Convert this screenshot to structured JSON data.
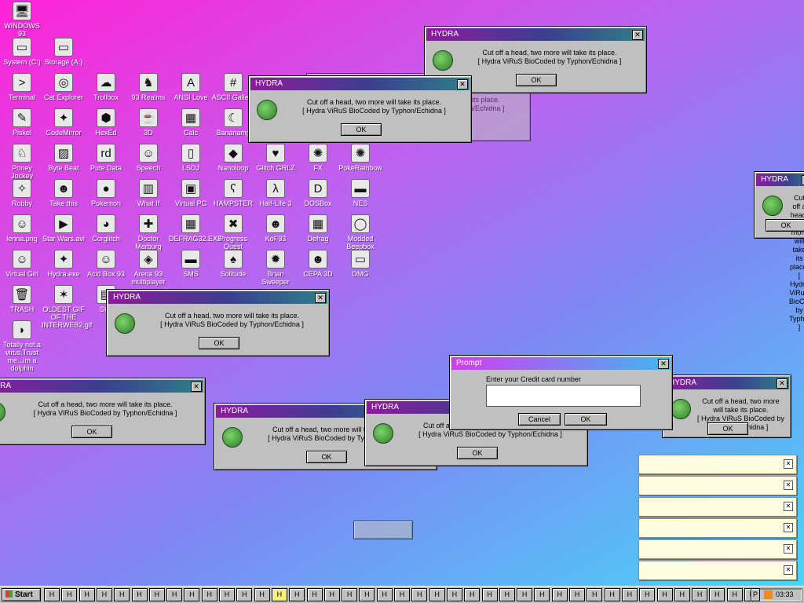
{
  "desktop_icons": [
    {
      "label": "WINDOWS 93",
      "icon": "computer-icon",
      "glyph": "🖥"
    },
    {
      "label": "System (C:)",
      "icon": "drive-icon",
      "glyph": "▭"
    },
    {
      "label": "Storage (A:)",
      "icon": "floppy-drive-icon",
      "glyph": "▭"
    },
    {
      "label": "Terminal",
      "icon": "terminal-icon",
      "glyph": ">"
    },
    {
      "label": "Cat Explorer",
      "icon": "globe-icon",
      "glyph": "◎"
    },
    {
      "label": "Trollbox",
      "icon": "chat-icon",
      "glyph": "☁"
    },
    {
      "label": "93 Realms",
      "icon": "realms-icon",
      "glyph": "♞"
    },
    {
      "label": "ANSI Love",
      "icon": "ansi-icon",
      "glyph": "A"
    },
    {
      "label": "ASCII Gallery",
      "icon": "ascii-icon",
      "glyph": "#"
    },
    {
      "label": "Piskel",
      "icon": "paint-icon",
      "glyph": "✎"
    },
    {
      "label": "CodeMirror",
      "icon": "codemirror-icon",
      "glyph": "✦"
    },
    {
      "label": "HexEd",
      "icon": "hex-icon",
      "glyph": "⬢"
    },
    {
      "label": "3D",
      "icon": "teapot-icon",
      "glyph": "☕"
    },
    {
      "label": "Calc",
      "icon": "calculator-icon",
      "glyph": "▦"
    },
    {
      "label": "Bananamp",
      "icon": "banana-icon",
      "glyph": "☾"
    },
    {
      "label": "Poney Jockey",
      "icon": "pony-icon",
      "glyph": "♘"
    },
    {
      "label": "Byte Beat",
      "icon": "bytebeat-icon",
      "glyph": "▨"
    },
    {
      "label": "Pute Data",
      "icon": "data-icon",
      "glyph": "rd"
    },
    {
      "label": "Speech",
      "icon": "speech-icon",
      "glyph": "☺"
    },
    {
      "label": "LSDJ",
      "icon": "gameboy-icon",
      "glyph": "▯"
    },
    {
      "label": "Nanoloop",
      "icon": "nanoloop-icon",
      "glyph": "◆"
    },
    {
      "label": "Glitch GRLZ",
      "icon": "glitch-icon",
      "glyph": "♥"
    },
    {
      "label": "FX",
      "icon": "fx-icon",
      "glyph": "✺"
    },
    {
      "label": "PokeRainbow",
      "icon": "rainbow-icon",
      "glyph": "✺"
    },
    {
      "label": "Robby",
      "icon": "robby-icon",
      "glyph": "✧"
    },
    {
      "label": "Take this",
      "icon": "take-this-icon",
      "glyph": "☻"
    },
    {
      "label": "Pokemon",
      "icon": "pokemon-icon",
      "glyph": "●"
    },
    {
      "label": "What If",
      "icon": "whatif-icon",
      "glyph": "▥"
    },
    {
      "label": "Virtual PC",
      "icon": "virtual-pc-icon",
      "glyph": "▣"
    },
    {
      "label": "HAMPSTER",
      "icon": "hamster-icon",
      "glyph": "ʕ"
    },
    {
      "label": "Half-Life 3",
      "icon": "half-life-icon",
      "glyph": "λ"
    },
    {
      "label": "DOSBox",
      "icon": "dosbox-icon",
      "glyph": "D"
    },
    {
      "label": "NES",
      "icon": "nes-icon",
      "glyph": "▬"
    },
    {
      "label": "lenna.png",
      "icon": "image-icon",
      "glyph": "☺"
    },
    {
      "label": "Star Wars.avi",
      "icon": "video-icon",
      "glyph": "▶"
    },
    {
      "label": "Corglitch",
      "icon": "corgi-icon",
      "glyph": "◕"
    },
    {
      "label": "Doctor Marburg",
      "icon": "doctor-icon",
      "glyph": "✚"
    },
    {
      "label": "DEFRAG32.EXE",
      "icon": "defrag-exe-icon",
      "glyph": "▦"
    },
    {
      "label": "Progress Quest",
      "icon": "quest-icon",
      "glyph": "✖"
    },
    {
      "label": "KoF93",
      "icon": "kof-icon",
      "glyph": "☻"
    },
    {
      "label": "Defrag",
      "icon": "defrag-icon",
      "glyph": "▦"
    },
    {
      "label": "Modded Beepbox",
      "icon": "beepbox-icon",
      "glyph": "◯"
    },
    {
      "label": "Virtual Girl",
      "icon": "virtual-girl-icon",
      "glyph": "☺"
    },
    {
      "label": "Hydra.exe",
      "icon": "hydra-icon",
      "glyph": "✦"
    },
    {
      "label": "Acid Box 93",
      "icon": "acid-icon",
      "glyph": "☺"
    },
    {
      "label": "Arena 93 multiplayer",
      "icon": "arena-icon",
      "glyph": "◈"
    },
    {
      "label": "SMS",
      "icon": "sms-icon",
      "glyph": "▬"
    },
    {
      "label": "Solitude",
      "icon": "solitude-icon",
      "glyph": "♠"
    },
    {
      "label": "Brian Sweeper",
      "icon": "sweeper-icon",
      "glyph": "✹"
    },
    {
      "label": "CEPA 3D",
      "icon": "cepa-icon",
      "glyph": "☻"
    },
    {
      "label": "DMG",
      "icon": "dmg-icon",
      "glyph": "▭"
    },
    {
      "label": "TRASH",
      "icon": "trash-icon",
      "glyph": "🗑"
    },
    {
      "label": "OLDEST GIF OF THE INTERWEB2.gif",
      "icon": "gif-icon",
      "glyph": "✶"
    },
    {
      "label": "SIM",
      "icon": "sim-icon",
      "glyph": "▤"
    },
    {
      "label": "Totally not a virus.Trust me...im a dolphin",
      "icon": "dolphin-icon",
      "glyph": "◗"
    }
  ],
  "hydra": {
    "title": "HYDRA",
    "line1": "Cut off a head, two more will take its place.",
    "line2": "[ Hydra ViRuS BioCoded by Typhon/Echidna ]",
    "ok": "OK",
    "close": "✕"
  },
  "prompt": {
    "title": "Prompt",
    "label": "Enter your Credit card number",
    "value": "",
    "cancel": "Cancel",
    "ok": "OK",
    "close": "✕"
  },
  "notifications": {
    "close": "✕"
  },
  "taskbar": {
    "start": "Start",
    "button_label": "H",
    "last_button_label": "P",
    "clock": "03:33"
  },
  "colors": {
    "titlebar_start": "#8d1a9e",
    "titlebar_end": "#2e7f8a",
    "desktop_top": "#ff22d6",
    "desktop_bottom": "#46d8f6"
  }
}
